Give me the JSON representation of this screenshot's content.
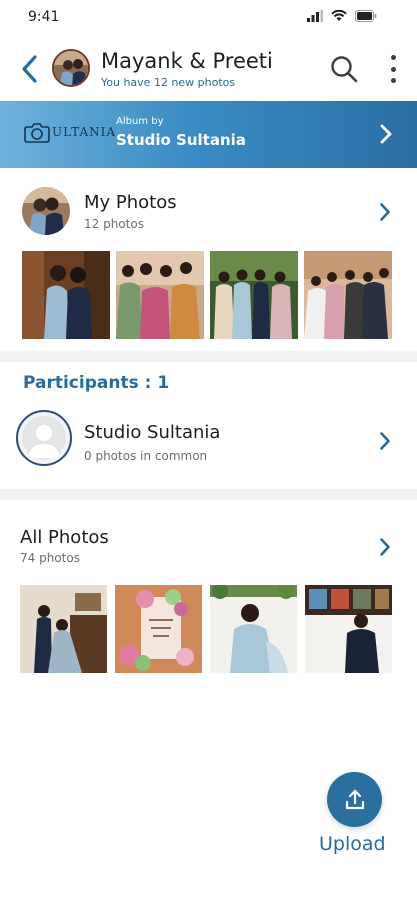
{
  "status": {
    "time": "9:41"
  },
  "header": {
    "title": "Mayank & Preeti",
    "subtitle": "You have 12 new photos"
  },
  "banner": {
    "logo_text": "ULTANIA",
    "pre_label": "Album by",
    "studio_name": "Studio Sultania"
  },
  "my_photos": {
    "title": "My Photos",
    "count_label": "12 photos"
  },
  "participants": {
    "label": "Participants : 1",
    "items": [
      {
        "name": "Studio Sultania",
        "detail": "0 photos in common"
      }
    ]
  },
  "all_photos": {
    "title": "All Photos",
    "count_label": "74 photos"
  },
  "upload": {
    "label": "Upload"
  },
  "colors": {
    "accent": "#2b6b9c",
    "fab": "#2b6fa0",
    "banner_start": "#6fb2dc",
    "banner_end": "#2a6fa5"
  }
}
